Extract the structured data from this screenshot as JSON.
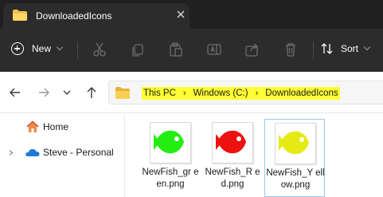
{
  "window": {
    "tab_title": "DownloadedIcons",
    "tab_close_icon": "close-icon"
  },
  "toolbar": {
    "new_label": "New",
    "sort_label": "Sort",
    "icons": [
      "cut-icon",
      "copy-icon",
      "paste-icon",
      "rename-icon",
      "share-icon",
      "delete-icon"
    ]
  },
  "address": {
    "crumbs": [
      "This PC",
      "Windows (C:)",
      "DownloadedIcons"
    ],
    "highlight_color": "#ffff33"
  },
  "sidebar": {
    "items": [
      {
        "label": "Home",
        "icon": "home-icon"
      },
      {
        "label": "Steve - Personal",
        "icon": "onedrive-cloud-icon"
      }
    ]
  },
  "files": [
    {
      "name": "NewFish_green.png",
      "display_name": "NewFish_gr een.png",
      "color": "#22ee11",
      "selected": false
    },
    {
      "name": "NewFish_Red.png",
      "display_name": "NewFish_R ed.png",
      "color": "#ee1111",
      "selected": false
    },
    {
      "name": "NewFish_Yellow.png",
      "display_name": "NewFish_Y ellow.png",
      "color": "#e5ea14",
      "selected": true
    }
  ]
}
